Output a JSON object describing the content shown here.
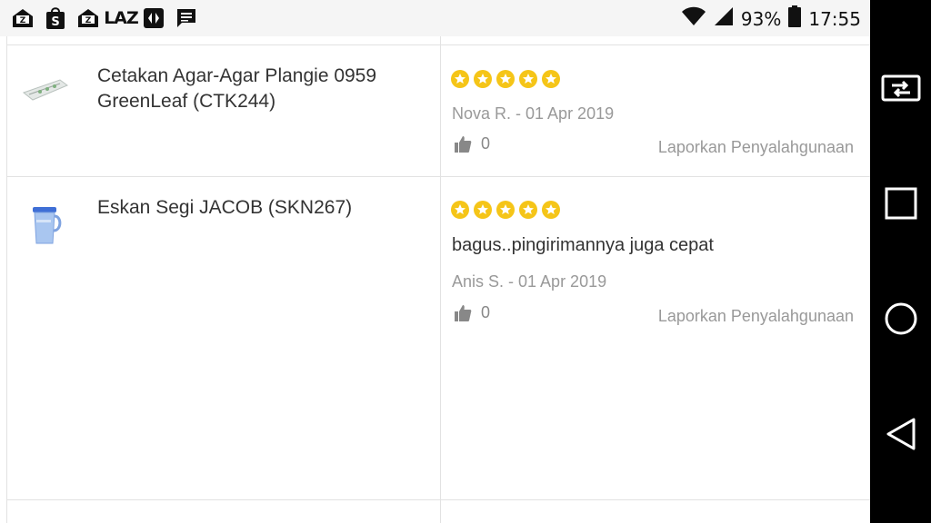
{
  "status_bar": {
    "left_icons": [
      "mail-icon",
      "shopee-icon",
      "mail-icon",
      "lazada-icon",
      "app-icon",
      "message-icon"
    ],
    "lazada_label": "LAZ",
    "battery_percent": "93%",
    "time": "17:55"
  },
  "nav_bar": {
    "buttons": [
      "screen-mirror-icon",
      "recent-apps-icon",
      "home-icon",
      "back-icon"
    ]
  },
  "reviews": [
    {
      "product_name": "Cetakan Agar-Agar Plangie 0959 GreenLeaf (CTK244)",
      "rating": 5,
      "review_text": "",
      "author_date": "Nova R. - 01 Apr 2019",
      "likes": "0",
      "report_label": "Laporkan Penyalahgunaan"
    },
    {
      "product_name": "Eskan Segi JACOB (SKN267)",
      "rating": 5,
      "review_text": "bagus..pingirimannya juga cepat",
      "author_date": "Anis S. - 01 Apr 2019",
      "likes": "0",
      "report_label": "Laporkan Penyalahgunaan"
    }
  ],
  "colors": {
    "star": "#f5c518",
    "divider": "#e2e2e2",
    "muted_text": "#999999",
    "body_text": "#333333"
  }
}
